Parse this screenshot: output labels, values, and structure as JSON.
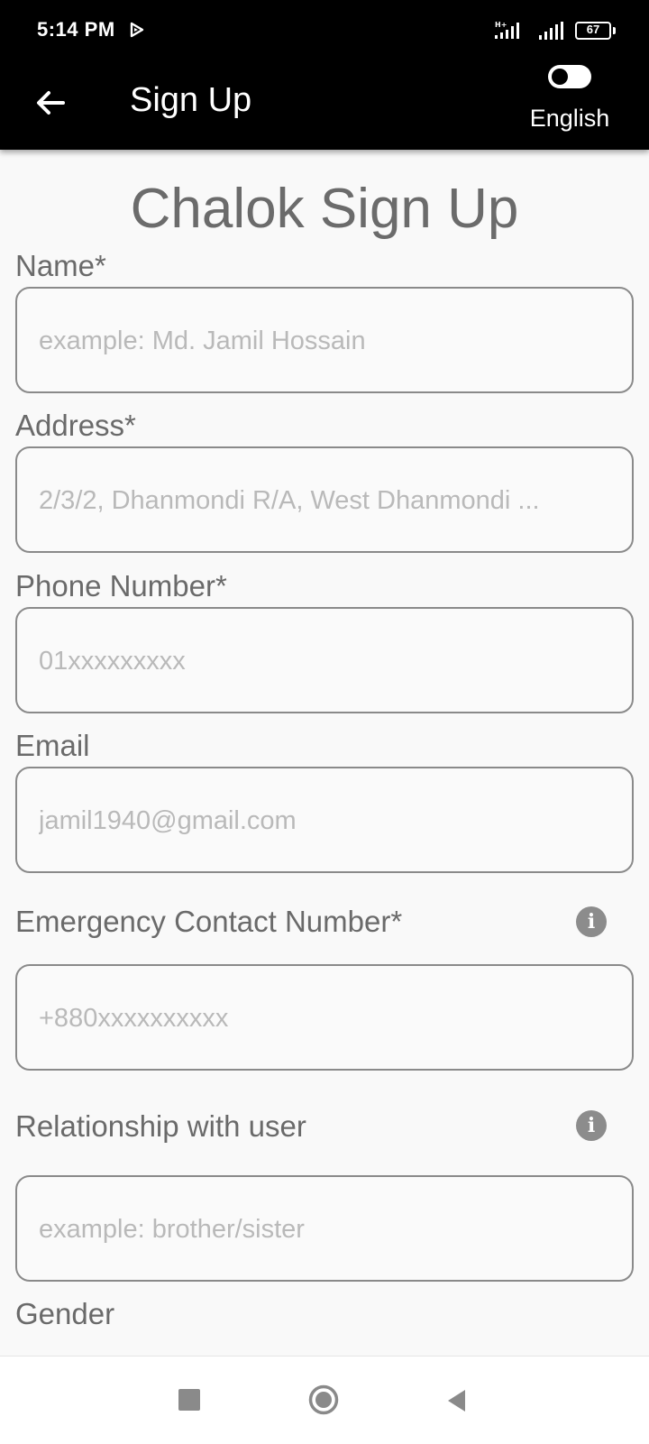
{
  "status_bar": {
    "time": "5:14 PM",
    "battery": "67",
    "icons": [
      "media-play-icon",
      "signal-hplus-icon",
      "signal-icon",
      "battery-icon"
    ]
  },
  "app_bar": {
    "title": "Sign Up",
    "language_label": "English",
    "icons": [
      "back-arrow-icon",
      "toggle-switch-icon"
    ]
  },
  "form": {
    "heading": "Chalok Sign Up",
    "fields": [
      {
        "label": "Name*",
        "placeholder": "example: Md. Jamil Hossain",
        "value": ""
      },
      {
        "label": "Address*",
        "placeholder": "2/3/2, Dhanmondi R/A, West Dhanmondi ...",
        "value": ""
      },
      {
        "label": "Phone Number*",
        "placeholder": "01xxxxxxxxx",
        "value": ""
      },
      {
        "label": "Email",
        "placeholder": "jamil1940@gmail.com",
        "value": ""
      },
      {
        "label": "Emergency Contact Number*",
        "placeholder": "+880xxxxxxxxxx",
        "value": "",
        "info_icon": "info-icon"
      },
      {
        "label": "Relationship with user",
        "placeholder": "example: brother/sister",
        "value": "",
        "info_icon": "info-icon"
      }
    ],
    "next_section_label": "Gender"
  },
  "nav_bar": {
    "icons": [
      "recent-apps-icon",
      "home-icon",
      "back-icon"
    ]
  },
  "colors": {
    "app_bar_bg": "#000000",
    "page_bg": "#f9f9f9",
    "label_text": "#6a6a6a",
    "input_border": "#8a8a8a",
    "placeholder": "#b9b9b9"
  }
}
